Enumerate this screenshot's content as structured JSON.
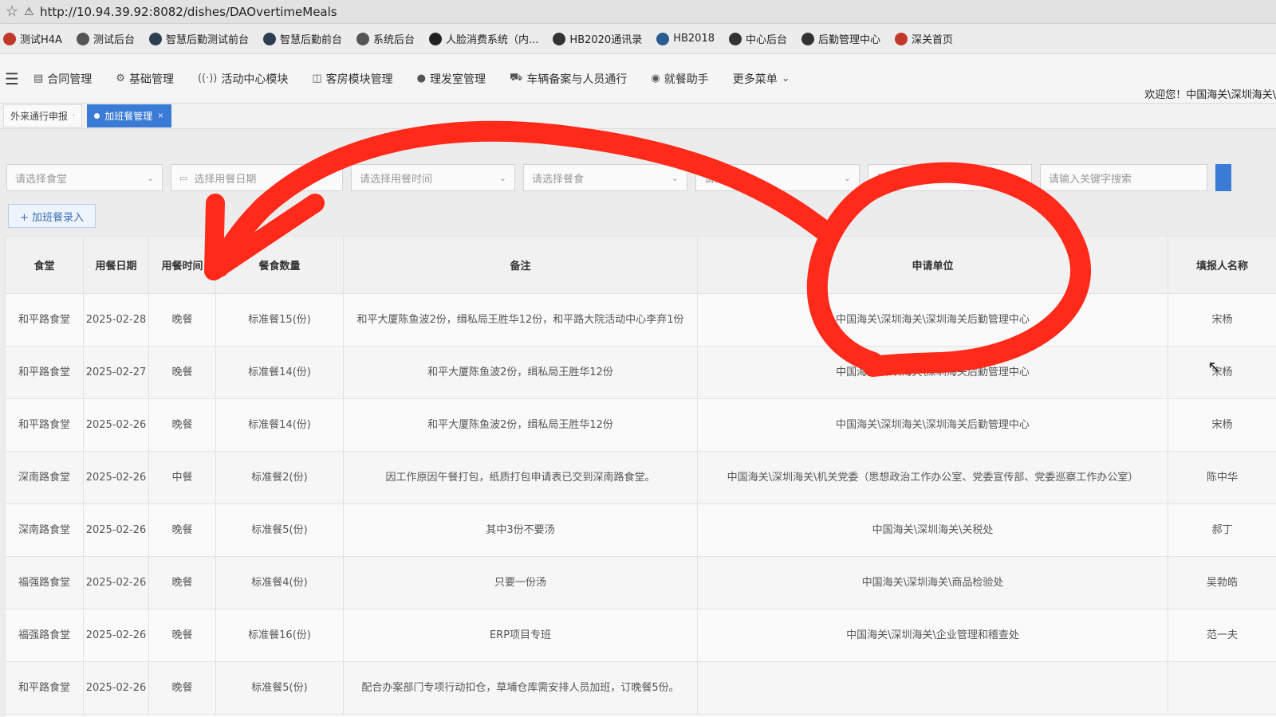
{
  "browser": {
    "url": "http://10.94.39.92:8082/dishes/DAOvertimeMeals"
  },
  "bookmarks": [
    {
      "label": "测试H4A",
      "color": "#c0392b"
    },
    {
      "label": "测试后台",
      "color": "#555555"
    },
    {
      "label": "智慧后勤测试前台",
      "color": "#2c3e50"
    },
    {
      "label": "智慧后勤前台",
      "color": "#2c3e50"
    },
    {
      "label": "系统后台",
      "color": "#555555"
    },
    {
      "label": "人脸消费系统（内...",
      "color": "#222222"
    },
    {
      "label": "HB2020通讯录",
      "color": "#333333"
    },
    {
      "label": "HB2018",
      "color": "#2a5d8f"
    },
    {
      "label": "中心后台",
      "color": "#333333"
    },
    {
      "label": "后勤管理中心",
      "color": "#333333"
    },
    {
      "label": "深关首页",
      "color": "#c0392b"
    }
  ],
  "nav": {
    "items": [
      {
        "label": "合同管理",
        "icon": "document-icon"
      },
      {
        "label": "基础管理",
        "icon": "gear-icon"
      },
      {
        "label": "活动中心模块",
        "icon": "broadcast-icon"
      },
      {
        "label": "客房模块管理",
        "icon": "room-icon"
      },
      {
        "label": "理发室管理",
        "icon": "person-icon"
      },
      {
        "label": "车辆备案与人员通行",
        "icon": "car-icon"
      },
      {
        "label": "就餐助手",
        "icon": "meal-icon"
      },
      {
        "label": "更多菜单",
        "icon": "chevron-down-icon"
      }
    ],
    "welcome": "欢迎您！中国海关\\深圳海关\\"
  },
  "tabs": [
    {
      "label": "外来通行申报"
    },
    {
      "label": "加班餐管理",
      "active": true
    }
  ],
  "filters": {
    "canteen": "请选择食堂",
    "date": "选择用餐日期",
    "time": "请选择用餐时间",
    "meal": "请选择餐食",
    "other": "请选择",
    "supplement": "是否补单",
    "keyword": "请输入关键字搜索"
  },
  "add_button": "+ 加班餐录入",
  "table": {
    "headers": [
      "食堂",
      "用餐日期",
      "用餐时间",
      "餐食数量",
      "备注",
      "申请单位",
      "填报人名称"
    ],
    "rows": [
      {
        "canteen": "和平路食堂",
        "date": "2025-02-28",
        "time": "晚餐",
        "qty": "标准餐15(份)",
        "note": "和平大厦陈鱼波2份，缉私局王胜华12份，和平路大院活动中心李弃1份",
        "unit": "中国海关\\深圳海关\\深圳海关后勤管理中心",
        "person": "宋杨"
      },
      {
        "canteen": "和平路食堂",
        "date": "2025-02-27",
        "time": "晚餐",
        "qty": "标准餐14(份)",
        "note": "和平大厦陈鱼波2份，缉私局王胜华12份",
        "unit": "中国海关\\深圳海关\\深圳海关后勤管理中心",
        "person": "宋杨"
      },
      {
        "canteen": "和平路食堂",
        "date": "2025-02-26",
        "time": "晚餐",
        "qty": "标准餐14(份)",
        "note": "和平大厦陈鱼波2份，缉私局王胜华12份",
        "unit": "中国海关\\深圳海关\\深圳海关后勤管理中心",
        "person": "宋杨"
      },
      {
        "canteen": "深南路食堂",
        "date": "2025-02-26",
        "time": "中餐",
        "qty": "标准餐2(份)",
        "note": "因工作原因午餐打包，纸质打包申请表已交到深南路食堂。",
        "unit": "中国海关\\深圳海关\\机关党委（思想政治工作办公室、党委宣传部、党委巡察工作办公室）",
        "person": "陈中华"
      },
      {
        "canteen": "深南路食堂",
        "date": "2025-02-26",
        "time": "晚餐",
        "qty": "标准餐5(份)",
        "note": "其中3份不要汤",
        "unit": "中国海关\\深圳海关\\关税处",
        "person": "郝丁"
      },
      {
        "canteen": "福强路食堂",
        "date": "2025-02-26",
        "time": "晚餐",
        "qty": "标准餐4(份)",
        "note": "只要一份汤",
        "unit": "中国海关\\深圳海关\\商品检验处",
        "person": "吴勃皓"
      },
      {
        "canteen": "福强路食堂",
        "date": "2025-02-26",
        "time": "晚餐",
        "qty": "标准餐16(份)",
        "note": "ERP项目专班",
        "unit": "中国海关\\深圳海关\\企业管理和稽查处",
        "person": "范一夫"
      },
      {
        "canteen": "和平路食堂",
        "date": "2025-02-26",
        "time": "晚餐",
        "qty": "标准餐5(份)",
        "note": "配合办案部门专项行动扣仓，草埔仓库需安排人员加班，订晚餐5份。",
        "unit": "",
        "person": ""
      }
    ]
  },
  "annotation_color": "#ff2a1a"
}
